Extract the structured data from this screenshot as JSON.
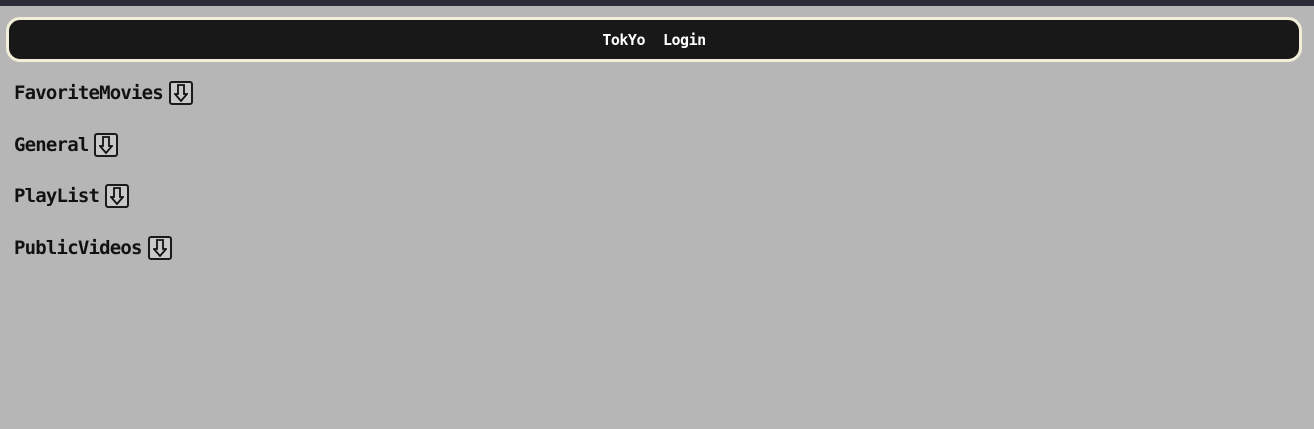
{
  "nav": {
    "links": [
      {
        "label": "TokYo"
      },
      {
        "label": "Login"
      }
    ]
  },
  "categories": [
    {
      "label": "FavoriteMovies",
      "icon": "down-arrow-icon"
    },
    {
      "label": "General",
      "icon": "down-arrow-icon"
    },
    {
      "label": "PlayList",
      "icon": "down-arrow-icon"
    },
    {
      "label": "PublicVideos",
      "icon": "down-arrow-icon"
    }
  ],
  "colors": {
    "background": "#b6b6b6",
    "navbar": "#181818",
    "navbar_border": "#f1efd8",
    "nav_text": "#ffffff"
  }
}
